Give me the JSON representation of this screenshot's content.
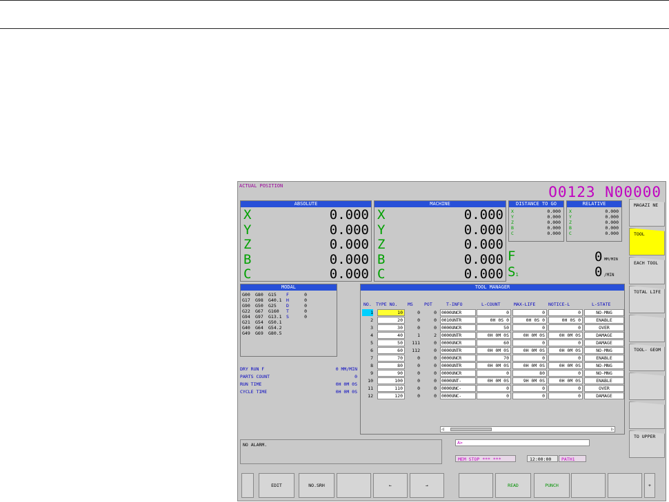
{
  "header": {
    "title": "ACTUAL POSITION",
    "program": "O0123 N00000"
  },
  "absolute": {
    "title": "ABSOLUTE",
    "rows": [
      {
        "axis": "X",
        "value": "0.000"
      },
      {
        "axis": "Y",
        "value": "0.000"
      },
      {
        "axis": "Z",
        "value": "0.000"
      },
      {
        "axis": "B",
        "value": "0.000"
      },
      {
        "axis": "C",
        "value": "0.000"
      }
    ]
  },
  "machine": {
    "title": "MACHINE",
    "rows": [
      {
        "axis": "X",
        "value": "0.000"
      },
      {
        "axis": "Y",
        "value": "0.000"
      },
      {
        "axis": "Z",
        "value": "0.000"
      },
      {
        "axis": "B",
        "value": "0.000"
      },
      {
        "axis": "C",
        "value": "0.000"
      }
    ]
  },
  "dtg": {
    "title": "DISTANCE TO GO",
    "rows": [
      {
        "axis": "X",
        "value": "0.000"
      },
      {
        "axis": "Y",
        "value": "0.000"
      },
      {
        "axis": "Z",
        "value": "0.000"
      },
      {
        "axis": "B",
        "value": "0.000"
      },
      {
        "axis": "C",
        "value": "0.000"
      }
    ]
  },
  "relative": {
    "title": "RELATIVE",
    "rows": [
      {
        "axis": "X",
        "value": "0.000"
      },
      {
        "axis": "Y",
        "value": "0.000"
      },
      {
        "axis": "Z",
        "value": "0.000"
      },
      {
        "axis": "B",
        "value": "0.000"
      },
      {
        "axis": "C",
        "value": "0.000"
      }
    ]
  },
  "feed": {
    "f_label": "F",
    "f_value": "0",
    "f_unit": "MM/MIN",
    "s_label": "S",
    "s_sub": "1",
    "s_value": "0",
    "s_unit": "/MIN"
  },
  "modal": {
    "title": "MODAL",
    "rows": [
      {
        "a": "G00",
        "b": "G80",
        "c": "G15",
        "l": "F",
        "n": "0"
      },
      {
        "a": "G17",
        "b": "G98",
        "c": "G40.1",
        "l": "H",
        "n": "0"
      },
      {
        "a": "G90",
        "b": "G50",
        "c": "G25",
        "l": "D",
        "n": "0"
      },
      {
        "a": "G22",
        "b": "G67",
        "c": "G160",
        "l": "T",
        "n": "0"
      },
      {
        "a": "G94",
        "b": "G97",
        "c": "G13.1",
        "l": "S",
        "n": "0"
      },
      {
        "a": "G21",
        "b": "G54",
        "c": "G50.1",
        "l": "",
        "n": ""
      },
      {
        "a": "G40",
        "b": "G64",
        "c": "G54.2",
        "l": "",
        "n": ""
      },
      {
        "a": "G49",
        "b": "G69",
        "c": "G80.5",
        "l": "",
        "n": ""
      }
    ]
  },
  "info": [
    {
      "label": "DRY RUN F",
      "value": "0 MM/MIN"
    },
    {
      "label": "PARTS COUNT",
      "value": "0"
    },
    {
      "label": "RUN TIME",
      "value": "0H 0M 0S"
    },
    {
      "label": "CYCLE TIME",
      "value": "0H 0M 0S"
    }
  ],
  "tool_manager": {
    "title": "TOOL MANAGER",
    "headers": [
      "NO.",
      "TYPE NO.",
      "MS",
      "POT",
      "T-INFO",
      "L-COUNT",
      "MAX-LIFE",
      "NOTICE-L",
      "L-STATE"
    ],
    "rows": [
      {
        "no": "1",
        "type": "10",
        "ms": "0",
        "pot": "0",
        "tinfo": "0000UNCR",
        "lcount": "0",
        "maxlife": "0",
        "notice": "0",
        "state": "NO-MNG"
      },
      {
        "no": "2",
        "type": "20",
        "ms": "0",
        "pot": "0",
        "tinfo": "0010UNTR",
        "lcount": "0H 0S 0",
        "maxlife": "0H 0S 0",
        "notice": "0H 0S 0",
        "state": "ENABLE"
      },
      {
        "no": "3",
        "type": "30",
        "ms": "0",
        "pot": "0",
        "tinfo": "0000UNCR",
        "lcount": "50",
        "maxlife": "0",
        "notice": "0",
        "state": "OVER"
      },
      {
        "no": "4",
        "type": "40",
        "ms": "1",
        "pot": "2",
        "tinfo": "0000UNTR",
        "lcount": "0H 0M 0S",
        "maxlife": "0H 0M 0S",
        "notice": "0H 0M 0S",
        "state": "DAMAGE"
      },
      {
        "no": "5",
        "type": "50",
        "ms": "111",
        "pot": "0",
        "tinfo": "0000UNCR",
        "lcount": "60",
        "maxlife": "0",
        "notice": "0",
        "state": "DAMAGE"
      },
      {
        "no": "6",
        "type": "60",
        "ms": "112",
        "pot": "0",
        "tinfo": "0000UNTR",
        "lcount": "0H 0M 0S",
        "maxlife": "0H 0M 0S",
        "notice": "0H 0M 0S",
        "state": "NO-MNG"
      },
      {
        "no": "7",
        "type": "70",
        "ms": "0",
        "pot": "0",
        "tinfo": "0000UNCR",
        "lcount": "70",
        "maxlife": "0",
        "notice": "0",
        "state": "ENABLE"
      },
      {
        "no": "8",
        "type": "80",
        "ms": "0",
        "pot": "0",
        "tinfo": "0000UNTR",
        "lcount": "0H 0M 0S",
        "maxlife": "0H 0M 0S",
        "notice": "0H 0M 0S",
        "state": "NO-MNG"
      },
      {
        "no": "9",
        "type": "90",
        "ms": "0",
        "pot": "0",
        "tinfo": "0000UNCR",
        "lcount": "0",
        "maxlife": "80",
        "notice": "0",
        "state": "NO-MNG"
      },
      {
        "no": "10",
        "type": "100",
        "ms": "0",
        "pot": "0",
        "tinfo": "0000UNT-",
        "lcount": "0H 0M 0S",
        "maxlife": "9H 0M 0S",
        "notice": "0H 0M 0S",
        "state": "ENABLE"
      },
      {
        "no": "11",
        "type": "110",
        "ms": "0",
        "pot": "0",
        "tinfo": "0000UNC-",
        "lcount": "0",
        "maxlife": "0",
        "notice": "0",
        "state": "OVER"
      },
      {
        "no": "12",
        "type": "120",
        "ms": "0",
        "pot": "0",
        "tinfo": "0000UNC-",
        "lcount": "0",
        "maxlife": "0",
        "notice": "0",
        "state": "DAMAGE"
      }
    ]
  },
  "alarm": "NO ALARM.",
  "input_prompt": "A>",
  "status": {
    "mode": "MEM  STOP *** ***",
    "time": "12:00:00",
    "path": "PATH1"
  },
  "softkeys": [
    {
      "label": "MAGAZI NE",
      "active": false
    },
    {
      "label": "TOOL",
      "active": true
    },
    {
      "label": "EACH TOOL",
      "active": false
    },
    {
      "label": "TOTAL LIFE",
      "active": false
    },
    {
      "label": "",
      "active": false
    },
    {
      "label": "TOOL- GEOM",
      "active": false
    },
    {
      "label": "",
      "active": false
    },
    {
      "label": "",
      "active": false
    },
    {
      "label": "TO UPPER",
      "active": false
    }
  ],
  "bottom_keys": [
    "",
    "EDIT",
    "NO.SRH",
    "",
    "←",
    "→",
    "",
    "READ",
    "PUNCH",
    "",
    "",
    "+"
  ]
}
